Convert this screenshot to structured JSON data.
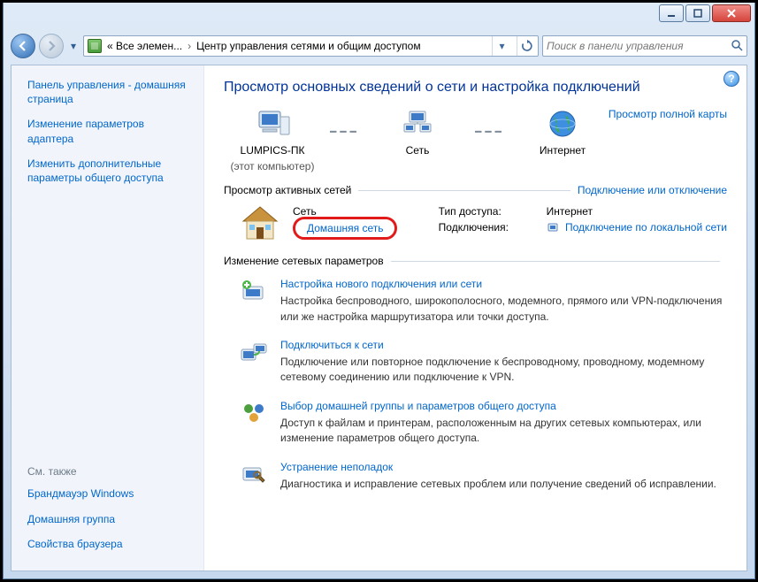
{
  "breadcrumb": {
    "seg1": "« Все элемен...",
    "seg2": "Центр управления сетями и общим доступом"
  },
  "search": {
    "placeholder": "Поиск в панели управления"
  },
  "sidebar": {
    "items": [
      "Панель управления - домашняя страница",
      "Изменение параметров адаптера",
      "Изменить дополнительные параметры общего доступа"
    ],
    "footer_head": "См. также",
    "footer_items": [
      "Брандмауэр Windows",
      "Домашняя группа",
      "Свойства браузера"
    ]
  },
  "main": {
    "title": "Просмотр основных сведений о сети и настройка подключений",
    "map": {
      "node1_label": "LUMPICS-ПК",
      "node1_sub": "(этот компьютер)",
      "node2_label": "Сеть",
      "node3_label": "Интернет",
      "full_map_link": "Просмотр полной карты"
    },
    "active_section": {
      "label": "Просмотр активных сетей",
      "right_link": "Подключение или отключение",
      "network": {
        "name": "Сеть",
        "type": "Домашняя сеть",
        "access_type_key": "Тип доступа:",
        "access_type_val": "Интернет",
        "connections_key": "Подключения:",
        "connections_val": "Подключение по локальной сети"
      }
    },
    "settings_section": {
      "label": "Изменение сетевых параметров",
      "items": [
        {
          "title": "Настройка нового подключения или сети",
          "desc": "Настройка беспроводного, широкополосного, модемного, прямого или VPN-подключения или же настройка маршрутизатора или точки доступа."
        },
        {
          "title": "Подключиться к сети",
          "desc": "Подключение или повторное подключение к беспроводному, проводному, модемному сетевому соединению или подключение к VPN."
        },
        {
          "title": "Выбор домашней группы и параметров общего доступа",
          "desc": "Доступ к файлам и принтерам, расположенным на других сетевых компьютерах, или изменение параметров общего доступа."
        },
        {
          "title": "Устранение неполадок",
          "desc": "Диагностика и исправление сетевых проблем или получение сведений об исправлении."
        }
      ]
    }
  }
}
